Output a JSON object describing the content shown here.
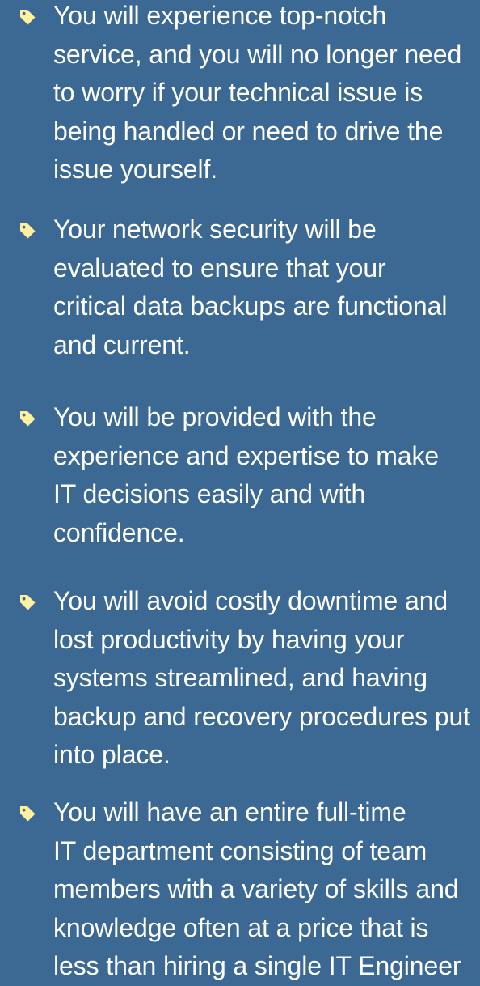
{
  "theme": {
    "background": "#3b6994",
    "text_color": "#ffffff",
    "bullet_color": "#fff0a0"
  },
  "bullet_icon": "tag-icon",
  "benefits": [
    {
      "lines": [
        "You will experience top-notch",
        "service, and you will no longer need",
        "to worry if your technical issue is",
        "being handled or need to drive the",
        "issue yourself."
      ]
    },
    {
      "lines": [
        "Your network security will be",
        "evaluated to ensure that your",
        "critical data backups are functional",
        "and current."
      ]
    },
    {
      "lines": [
        "You will be provided with the",
        "experience and expertise to make",
        "IT decisions easily and with",
        "confidence."
      ]
    },
    {
      "lines": [
        "You will avoid costly downtime and",
        "lost productivity by having your",
        "systems streamlined, and having",
        "backup and recovery procedures put",
        "into place."
      ]
    },
    {
      "lines": [
        "You will have an entire full-time",
        "IT department consisting of team",
        "members with a variety of skills and",
        "knowledge often at a price that is",
        "less than hiring a single IT Engineer"
      ]
    }
  ]
}
